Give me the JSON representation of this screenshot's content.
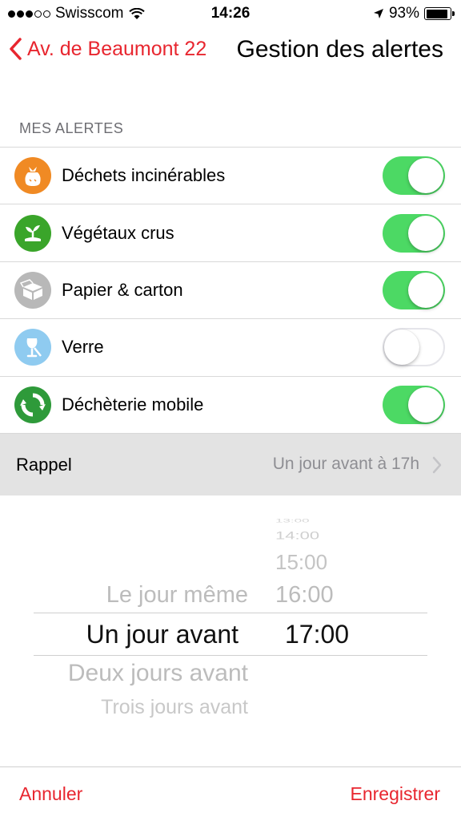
{
  "status_bar": {
    "carrier": "Swisscom",
    "time": "14:26",
    "battery": "93%",
    "battery_level": 0.93,
    "signal_bars_filled": 3,
    "signal_bars_total": 5
  },
  "nav": {
    "back_label": "Av. de Beaumont 22",
    "title": "Gestion des alertes"
  },
  "section": {
    "header": "MES ALERTES"
  },
  "alerts": [
    {
      "label": "Déchets incinérables",
      "enabled": true,
      "icon": "trash-bag-icon",
      "color": "#f08a24"
    },
    {
      "label": "Végétaux crus",
      "enabled": true,
      "icon": "plant-icon",
      "color": "#3aa52a"
    },
    {
      "label": "Papier & carton",
      "enabled": true,
      "icon": "box-icon",
      "color": "#b8b8b8"
    },
    {
      "label": "Verre",
      "enabled": false,
      "icon": "wine-glass-icon",
      "color": "#8fcbf0"
    },
    {
      "label": "Déchèterie mobile",
      "enabled": true,
      "icon": "recycle-icon",
      "color": "#2e9a3a"
    }
  ],
  "reminder": {
    "label": "Rappel",
    "value": "Un jour avant à 17h"
  },
  "picker": {
    "days": [
      "Le jour même",
      "Un jour avant",
      "Deux jours avant",
      "Trois jours avant"
    ],
    "selected_day": "Un jour avant",
    "hours": [
      "13:00",
      "14:00",
      "15:00",
      "16:00",
      "17:00"
    ],
    "selected_hour": "17:00"
  },
  "footer": {
    "cancel_label": "Annuler",
    "save_label": "Enregistrer"
  },
  "colors": {
    "accent": "#e8262f",
    "toggle_on": "#4cd964"
  }
}
